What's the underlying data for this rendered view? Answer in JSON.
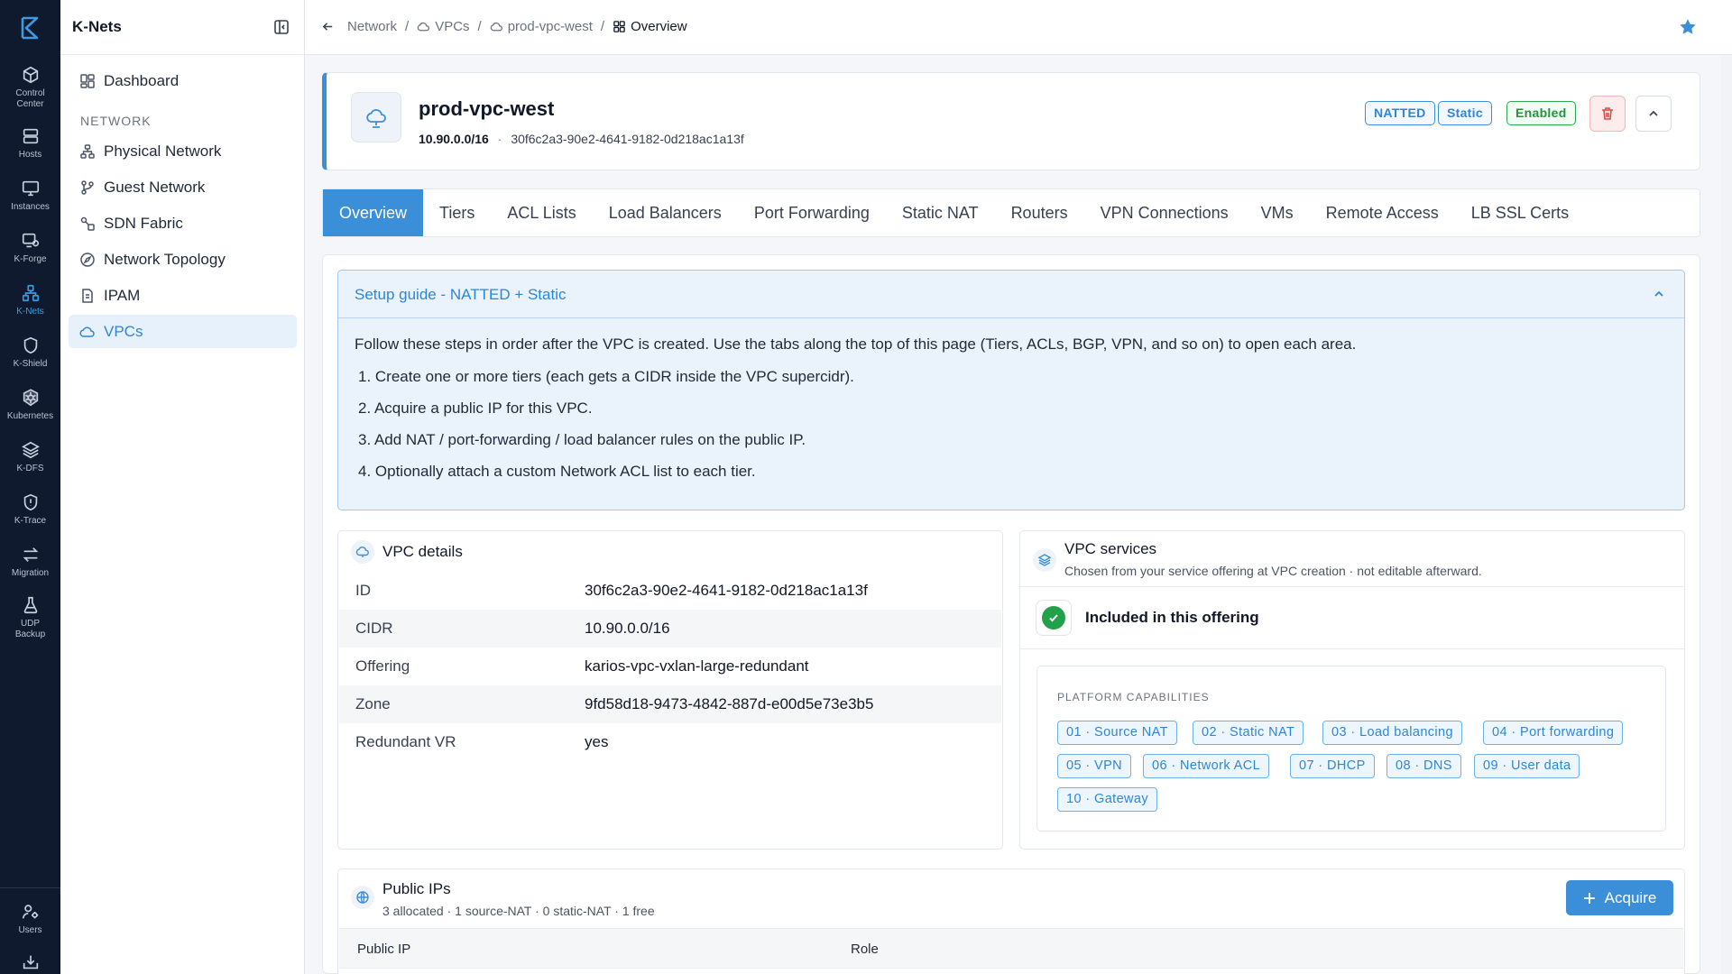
{
  "rail": {
    "items": [
      {
        "label": "Control\nCenter",
        "icon": "cube-icon"
      },
      {
        "label": "Hosts",
        "icon": "server-icon"
      },
      {
        "label": "Instances",
        "icon": "monitor-icon"
      },
      {
        "label": "K-Forge",
        "icon": "forge-icon"
      },
      {
        "label": "K-Nets",
        "icon": "network-icon",
        "active": true
      },
      {
        "label": "K-Shield",
        "icon": "shield-icon"
      },
      {
        "label": "Kubernetes",
        "icon": "kubernetes-icon"
      },
      {
        "label": "K-DFS",
        "icon": "layers-icon"
      },
      {
        "label": "K-Trace",
        "icon": "trace-shield-icon"
      },
      {
        "label": "Migration",
        "icon": "swap-arrows-icon"
      },
      {
        "label": "UDP\nBackup",
        "icon": "flask-icon"
      },
      {
        "label": "Users",
        "icon": "users-icon"
      }
    ]
  },
  "sidenav": {
    "title": "K-Nets",
    "dashboard": "Dashboard",
    "section": "NETWORK",
    "items": [
      "Physical Network",
      "Guest Network",
      "SDN Fabric",
      "Network Topology",
      "IPAM",
      "VPCs"
    ]
  },
  "breadcrumb": {
    "network": "Network",
    "vpcs": "VPCs",
    "vpc": "prod-vpc-west",
    "current": "Overview"
  },
  "header": {
    "name": "prod-vpc-west",
    "cidr": "10.90.0.0/16",
    "separator": "·",
    "id": "30f6c2a3-90e2-4641-9182-0d218ac1a13f",
    "badges": [
      "NATTED",
      "Static",
      "Enabled"
    ]
  },
  "tabs": [
    "Overview",
    "Tiers",
    "ACL Lists",
    "Load Balancers",
    "Port Forwarding",
    "Static NAT",
    "Routers",
    "VPN Connections",
    "VMs",
    "Remote Access",
    "LB SSL Certs"
  ],
  "guide": {
    "title": "Setup guide - NATTED + Static",
    "intro": "Follow these steps in order after the VPC is created. Use the tabs along the top of this page (Tiers, ACLs, BGP, VPN, and so on) to open each area.",
    "steps": [
      "1. Create one or more tiers (each gets a CIDR inside the VPC supercidr).",
      "2. Acquire a public IP for this VPC.",
      "3. Add NAT / port-forwarding / load balancer rules on the public IP.",
      "4. Optionally attach a custom Network ACL list to each tier."
    ]
  },
  "details": {
    "title": "VPC details",
    "rows": [
      {
        "k": "ID",
        "v": "30f6c2a3-90e2-4641-9182-0d218ac1a13f"
      },
      {
        "k": "CIDR",
        "v": "10.90.0.0/16"
      },
      {
        "k": "Offering",
        "v": "karios-vpc-vxlan-large-redundant"
      },
      {
        "k": "Zone",
        "v": "9fd58d18-9473-4842-887d-e00d5e73e3b5"
      },
      {
        "k": "Redundant VR",
        "v": "yes"
      }
    ]
  },
  "services": {
    "title": "VPC services",
    "subtitle": "Chosen from your service offering at VPC creation · not editable afterward.",
    "included": "Included in this offering",
    "caps_label": "PLATFORM CAPABILITIES",
    "caps": [
      "01 · Source NAT",
      "02 · Static NAT",
      "03 · Load balancing",
      "04 · Port forwarding",
      "05 · VPN",
      "06 · Network ACL",
      "07 · DHCP",
      "08 · DNS",
      "09 · User data",
      "10 · Gateway"
    ]
  },
  "public_ips": {
    "title": "Public IPs",
    "subtitle": "3 allocated · 1 source-NAT · 0 static-NAT · 1 free",
    "acquire": "Acquire",
    "columns": [
      "Public IP",
      "Role"
    ]
  },
  "colors": {
    "accent": "#3b8fd9",
    "rail_bg": "#0f1a2e",
    "success": "#22a04a",
    "danger": "#e04848"
  }
}
